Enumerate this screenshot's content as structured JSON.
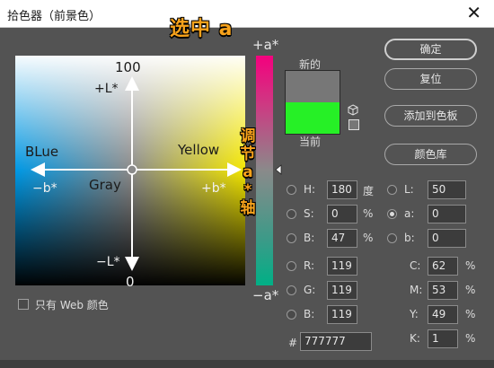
{
  "window": {
    "title": "拾色器（前景色）",
    "close_glyph": "✕"
  },
  "annotation": {
    "top": "选中 a",
    "side_chars": [
      "调",
      "节",
      "a",
      "*",
      "轴"
    ]
  },
  "field": {
    "top_value": "100",
    "bottom_value": "0",
    "plus_L": "+L*",
    "minus_L": "−L*",
    "minus_b": "−b*",
    "plus_b": "+b*",
    "blue_label": "BLue",
    "yellow_label": "Yellow",
    "gray_label": "Gray"
  },
  "slider": {
    "top_label": "+a*",
    "bottom_label": "−a*",
    "value_fraction": 0.5
  },
  "preview": {
    "new_label": "新的",
    "current_label": "当前",
    "new_color": "#777777",
    "current_color": "#26f026"
  },
  "buttons": {
    "ok": "确定",
    "reset": "复位",
    "add_to_swatches": "添加到色板",
    "color_libraries": "颜色库"
  },
  "hsb": {
    "h": {
      "label": "H:",
      "value": "180",
      "unit": "度"
    },
    "s": {
      "label": "S:",
      "value": "0",
      "unit": "%"
    },
    "b": {
      "label": "B:",
      "value": "47",
      "unit": "%"
    }
  },
  "lab": {
    "l": {
      "label": "L:",
      "value": "50"
    },
    "a": {
      "label": "a:",
      "value": "0"
    },
    "b": {
      "label": "b:",
      "value": "0"
    }
  },
  "rgb": {
    "r": {
      "label": "R:",
      "value": "119"
    },
    "g": {
      "label": "G:",
      "value": "119"
    },
    "b": {
      "label": "B:",
      "value": "119"
    }
  },
  "cmyk": {
    "c": {
      "label": "C:",
      "value": "62",
      "unit": "%"
    },
    "m": {
      "label": "M:",
      "value": "53",
      "unit": "%"
    },
    "y": {
      "label": "Y:",
      "value": "49",
      "unit": "%"
    },
    "k": {
      "label": "K:",
      "value": "1",
      "unit": "%"
    }
  },
  "hex": {
    "label": "#",
    "value": "777777"
  },
  "web_only": {
    "label": "只有 Web 颜色",
    "checked": false
  },
  "colors": {
    "selected_radio": "a"
  }
}
